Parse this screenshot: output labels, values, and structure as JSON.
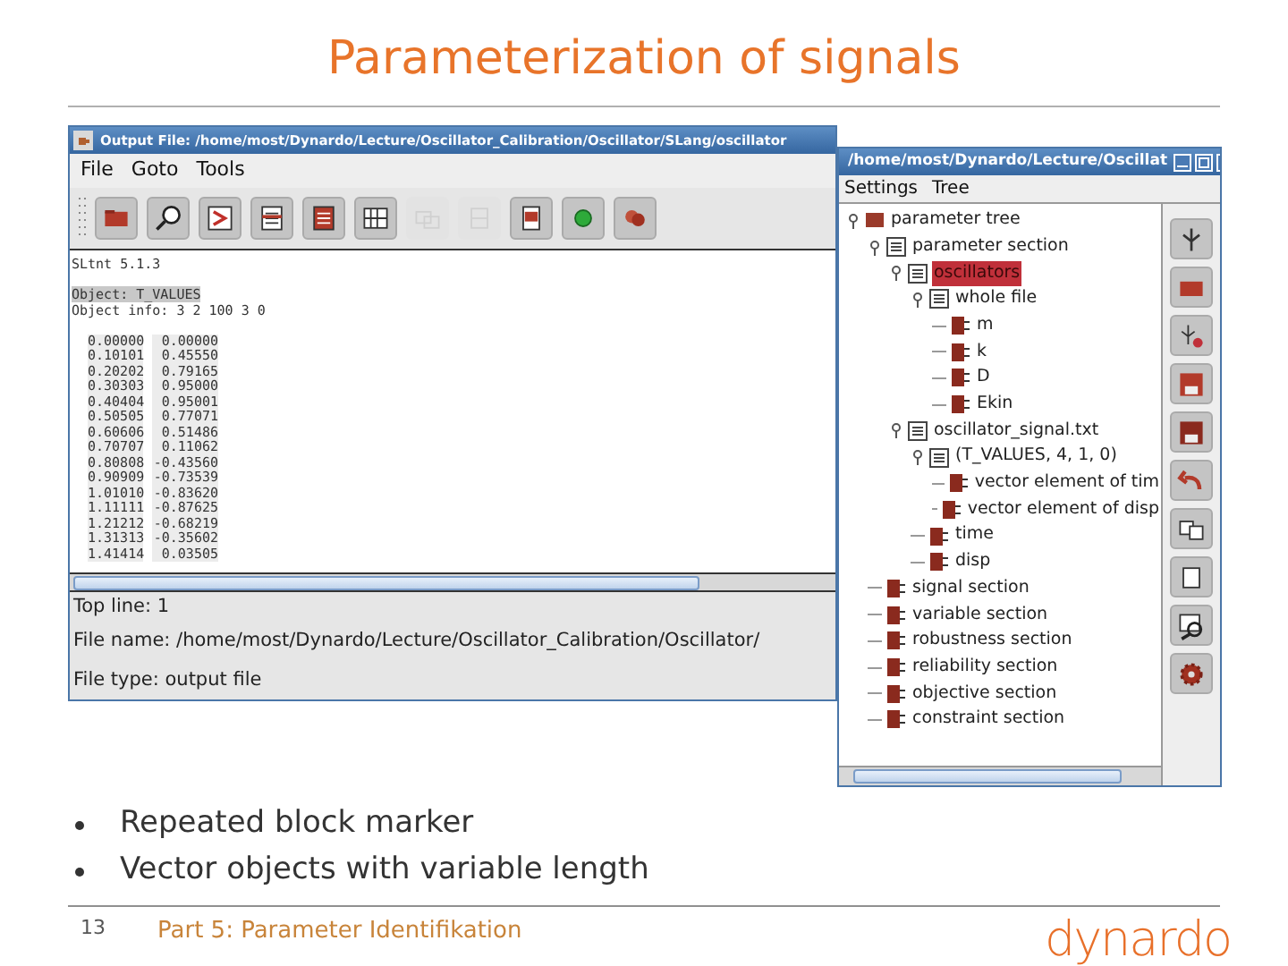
{
  "slide": {
    "title": "Parameterization of signals",
    "bullets": [
      "Repeated block marker",
      "Vector objects with variable length"
    ],
    "footer": {
      "page": "13",
      "text": "Part 5: Parameter Identifikation",
      "logo": "dynardo"
    }
  },
  "output_window": {
    "title": "Output File: /home/most/Dynardo/Lecture/Oscillator_Calibration/Oscillator/SLang/oscillator",
    "menu": [
      "File",
      "Goto",
      "Tools"
    ],
    "toolbar": [
      {
        "disabled": false
      },
      {
        "disabled": false
      },
      {
        "disabled": false
      },
      {
        "disabled": false
      },
      {
        "disabled": false
      },
      {
        "disabled": false
      },
      {
        "disabled": true
      },
      {
        "disabled": true
      },
      {
        "disabled": false
      },
      {
        "disabled": false
      },
      {
        "disabled": false
      }
    ],
    "lines": [
      {
        "text": "SLtnt 5.1.3",
        "highlighted": false
      },
      {
        "text": "Object: T_VALUES",
        "highlighted": true
      },
      {
        "text": "Object info: 3 2 100 3 0",
        "highlighted": false
      }
    ],
    "rows": [
      [
        "0.00000",
        "0.00000"
      ],
      [
        "0.10101",
        "0.45550"
      ],
      [
        "0.20202",
        "0.79165"
      ],
      [
        "0.30303",
        "0.95000"
      ],
      [
        "0.40404",
        "0.95001"
      ],
      [
        "0.50505",
        "0.77071"
      ],
      [
        "0.60606",
        "0.51486"
      ],
      [
        "0.70707",
        "0.11062"
      ],
      [
        "0.80808",
        "-0.43560"
      ],
      [
        "0.90909",
        "-0.73539"
      ],
      [
        "1.01010",
        "-0.83620"
      ],
      [
        "1.11111",
        "-0.87625"
      ],
      [
        "1.21212",
        "-0.68219"
      ],
      [
        "1.31313",
        "-0.35602"
      ],
      [
        "1.41414",
        "0.03505"
      ]
    ],
    "status": [
      "Top line: 1",
      "File name: /home/most/Dynardo/Lecture/Oscillator_Calibration/Oscillator/",
      "File type: output file"
    ]
  },
  "tree_window": {
    "title": "/home/most/Dynardo/Lecture/Oscillat",
    "menu": [
      "Settings",
      "Tree"
    ],
    "tree": [
      {
        "label": "parameter tree",
        "selected": false,
        "expanded": true,
        "children": [
          {
            "label": "parameter section",
            "selected": false,
            "expanded": true,
            "children": [
              {
                "label": "oscillators",
                "selected": true,
                "expanded": true,
                "children": [
                  {
                    "label": "whole file",
                    "selected": false,
                    "expanded": true,
                    "children": [
                      {
                        "label": "m",
                        "selected": false
                      },
                      {
                        "label": "k",
                        "selected": false
                      },
                      {
                        "label": "D",
                        "selected": false
                      },
                      {
                        "label": "Ekin",
                        "selected": false
                      }
                    ]
                  }
                ]
              },
              {
                "label": "oscillator_signal.txt",
                "selected": false,
                "expanded": true,
                "children": [
                  {
                    "label": "(T_VALUES, 4, 1, 0)",
                    "selected": false,
                    "expanded": true,
                    "children": [
                      {
                        "label": "vector element of tim",
                        "selected": false
                      },
                      {
                        "label": "vector element of disp",
                        "selected": false
                      }
                    ]
                  },
                  {
                    "label": "time",
                    "selected": false
                  },
                  {
                    "label": "disp",
                    "selected": false
                  }
                ]
              }
            ]
          },
          {
            "label": "signal section",
            "selected": false
          },
          {
            "label": "variable section",
            "selected": false
          },
          {
            "label": "robustness section",
            "selected": false
          },
          {
            "label": "reliability section",
            "selected": false
          },
          {
            "label": "objective section",
            "selected": false
          },
          {
            "label": "constraint section",
            "selected": false
          }
        ]
      }
    ]
  }
}
